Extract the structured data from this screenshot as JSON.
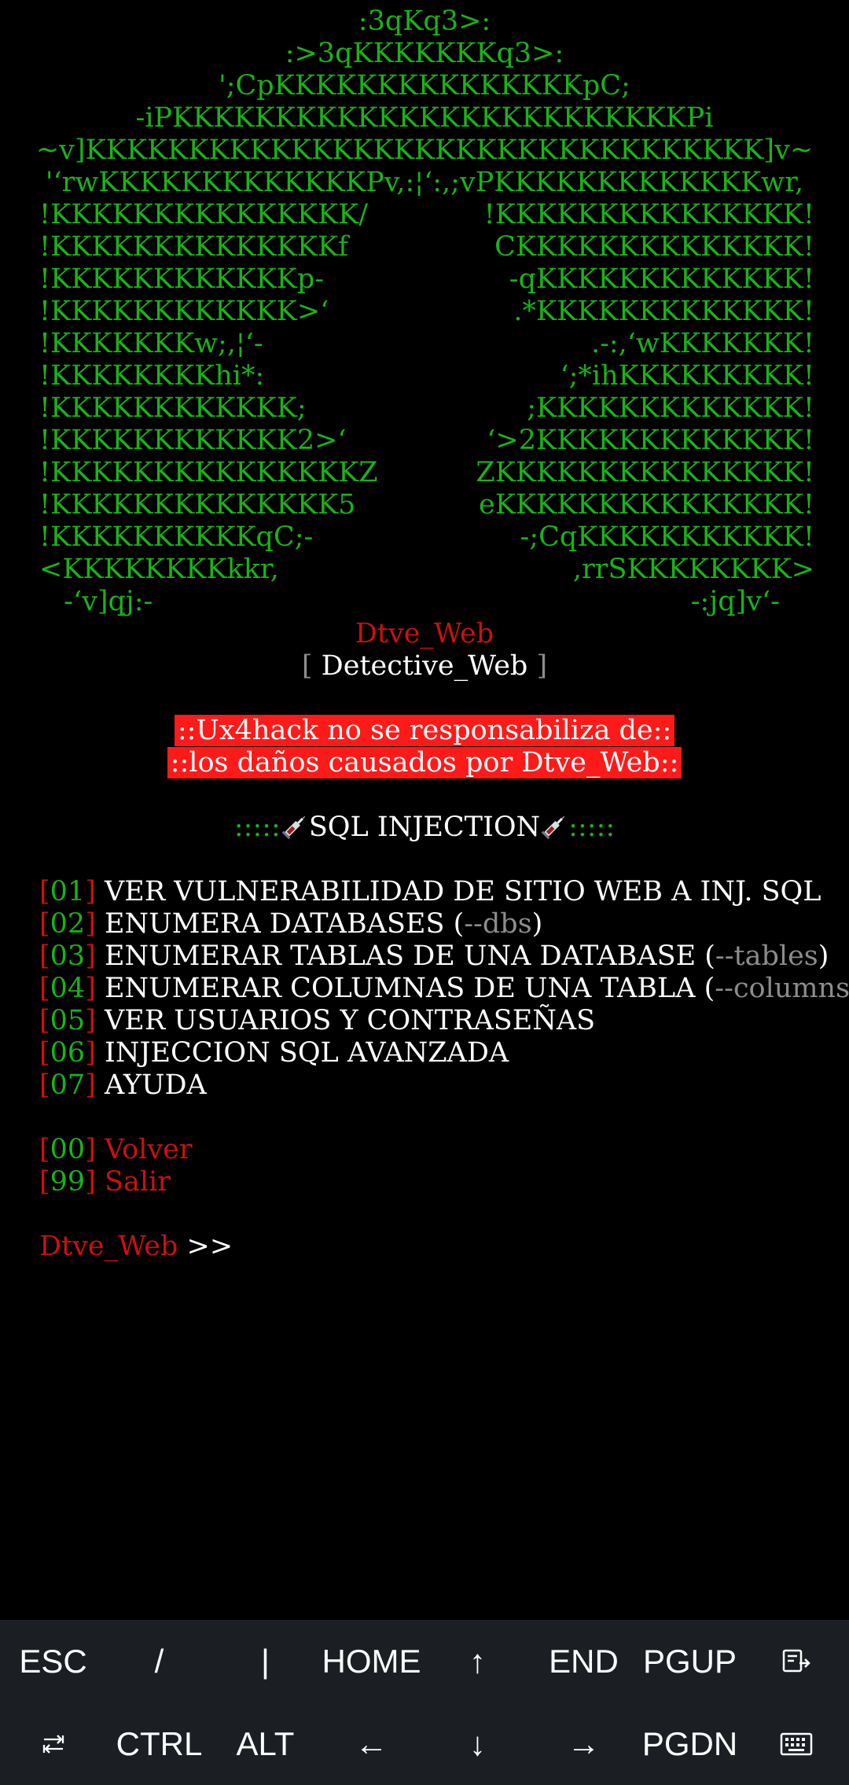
{
  "banner": {
    "art_lines": [
      ":3qKq3>:",
      ":>3qKKKKKKKq3>:",
      "';CpKKKKKKKKKKKKKKKpC;",
      "-iPKKKKKKKKKKKKKKKKKKKKKKKKKPi",
      "~v]KKKKKKKKKKKKKKKKKKKKKKKKKKKKKKKKK]v~",
      "'‘rwKKKKKKKKKKKKKPv,:¦‘:,;vPKKKKKKKKKKKKKwr,"
    ],
    "art_left": [
      "!KKKKKKKKKKKKKKK/",
      "!KKKKKKKKKKKKKKf",
      "!KKKKKKKKKKKKp-",
      "!KKKKKKKKKKKK>‘",
      "!KKKKKKKw;,¦‘-",
      "!KKKKKKKKhi*:",
      "!KKKKKKKKKKKK;",
      "!KKKKKKKKKKKK2>‘",
      "!KKKKKKKKKKKKKKKZ",
      "!KKKKKKKKKKKKKK5",
      "!KKKKKKKKKKqC;-",
      "<KKKKKKKKkkr,",
      " -‘v]qj:-"
    ],
    "art_right": [
      "!KKKKKKKKKKKKKKK!",
      "CKKKKKKKKKKKKKK!",
      "-qKKKKKKKKKKKKK!",
      ".*KKKKKKKKKKKKK!",
      ".-:,‘wKKKKKKK!",
      "‘;*ihKKKKKKKKK!",
      ";KKKKKKKKKKKKK!",
      "‘>2KKKKKKKKKKKKK!",
      "ZKKKKKKKKKKKKKKK!",
      "eKKKKKKKKKKKKKKK!",
      "-;CqKKKKKKKKKKK!",
      ",rrSKKKKKKKK>",
      "-:jq]v‘-"
    ],
    "tool_name": "Dtve_Web",
    "subtitle_open": "[",
    "subtitle": "Detective_Web",
    "subtitle_close": "]"
  },
  "warning": {
    "line1": "::Ux4hack no se responsabiliza de::",
    "line2": "::los daños causados por Dtve_Web::"
  },
  "section": {
    "deco_left": ":::::",
    "deco_right": ":::::",
    "icon": "syringe-icon",
    "title": "SQL INJECTION"
  },
  "menu": [
    {
      "num": "01",
      "label": "VER VULNERABILIDAD DE SITIO WEB A INJ. SQL",
      "flag": "",
      "tail": ""
    },
    {
      "num": "02",
      "label": "ENUMERA DATABASES (",
      "flag": "--dbs",
      "tail": ")"
    },
    {
      "num": "03",
      "label": "ENUMERAR TABLAS DE UNA DATABASE (",
      "flag": "--tables",
      "tail": ")"
    },
    {
      "num": "04",
      "label": "ENUMERAR COLUMNAS DE UNA TABLA (",
      "flag": "--columns",
      "tail": ")"
    },
    {
      "num": "05",
      "label": "VER USUARIOS Y CONTRASEÑAS",
      "flag": "",
      "tail": ""
    },
    {
      "num": "06",
      "label": "INJECCION SQL AVANZADA",
      "flag": "",
      "tail": ""
    },
    {
      "num": "07",
      "label": "AYUDA",
      "flag": "",
      "tail": ""
    }
  ],
  "nav": [
    {
      "num": "00",
      "label": "Volver"
    },
    {
      "num": "99",
      "label": "Salir"
    }
  ],
  "prompt": {
    "name": "Dtve_Web",
    "symbol": ">>"
  },
  "extra_keys": {
    "row1": [
      "ESC",
      "/",
      "|",
      "HOME",
      "↑",
      "END",
      "PGUP"
    ],
    "row1_icon": "text-select-icon",
    "row2_icon": "tab-icon",
    "row2": [
      "CTRL",
      "ALT",
      "←",
      "↓",
      "→",
      "PGDN"
    ],
    "row2_last_icon": "keyboard-icon"
  },
  "colors": {
    "background": "#000000",
    "green": "#19b319",
    "red": "#cc1010",
    "warning_bg": "#ff1a1a",
    "grey": "#8c8c8c",
    "keybar": "#1b1f23"
  }
}
